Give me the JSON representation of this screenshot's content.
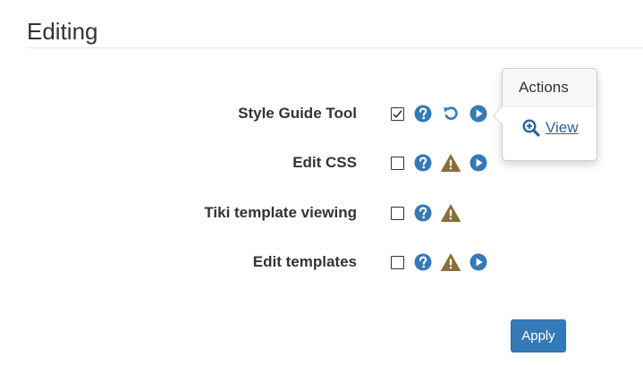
{
  "section": {
    "title": "Editing"
  },
  "preferences": [
    {
      "label": "Style Guide Tool",
      "checked": true,
      "icons": [
        "help-icon",
        "reset-icon",
        "actions-icon"
      ]
    },
    {
      "label": "Edit CSS",
      "checked": false,
      "icons": [
        "help-icon",
        "warning-icon",
        "actions-icon"
      ]
    },
    {
      "label": "Tiki template viewing",
      "checked": false,
      "icons": [
        "help-icon",
        "warning-icon"
      ]
    },
    {
      "label": "Edit templates",
      "checked": false,
      "icons": [
        "help-icon",
        "warning-icon",
        "actions-icon"
      ]
    }
  ],
  "popover": {
    "title": "Actions",
    "link_label": "View",
    "link_icon": "zoom-in-icon"
  },
  "apply_label": "Apply",
  "colors": {
    "primary": "#337ab7",
    "link": "#2a6496",
    "warning": "#8a6d3b",
    "text": "#333333"
  }
}
